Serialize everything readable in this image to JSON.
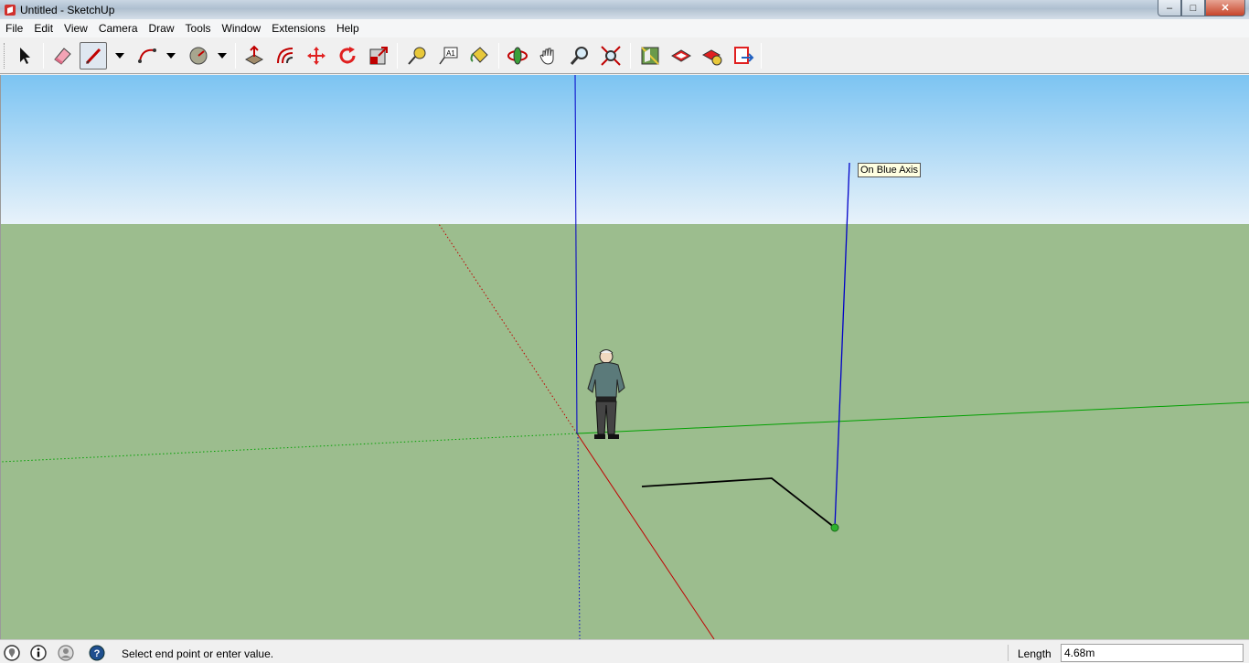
{
  "window": {
    "title": "Untitled - SketchUp",
    "controls": {
      "minimize": "–",
      "maximize": "□",
      "close": "✕"
    }
  },
  "menu": [
    "File",
    "Edit",
    "View",
    "Camera",
    "Draw",
    "Tools",
    "Window",
    "Extensions",
    "Help"
  ],
  "toolbar": {
    "tools": [
      {
        "name": "select-tool-icon"
      },
      {
        "name": "eraser-tool-icon"
      },
      {
        "name": "line-tool-icon",
        "active": true
      },
      {
        "name": "arc-tool-icon"
      },
      {
        "name": "shapes-tool-icon"
      },
      {
        "name": "push-pull-tool-icon"
      },
      {
        "name": "offset-tool-icon"
      },
      {
        "name": "move-tool-icon"
      },
      {
        "name": "rotate-tool-icon"
      },
      {
        "name": "scale-tool-icon"
      },
      {
        "name": "tape-measure-tool-icon"
      },
      {
        "name": "text-tool-icon"
      },
      {
        "name": "paint-bucket-tool-icon"
      },
      {
        "name": "orbit-tool-icon"
      },
      {
        "name": "pan-tool-icon"
      },
      {
        "name": "zoom-tool-icon"
      },
      {
        "name": "zoom-extents-tool-icon"
      },
      {
        "name": "warehouse-icon"
      },
      {
        "name": "extension-warehouse-icon"
      },
      {
        "name": "extension-manager-icon"
      },
      {
        "name": "send-to-layout-icon"
      }
    ],
    "text_tool_glyph": "A1"
  },
  "viewport": {
    "inference_tooltip": "On Blue Axis",
    "colors": {
      "sky_top": "#7cc4f2",
      "sky_bottom": "#e8f2fa",
      "ground": "#9cbd8e",
      "red_axis": "#c00000",
      "green_axis": "#00a000",
      "blue_axis": "#0000c8",
      "edge": "#000000",
      "endpoint": "#2db32d"
    }
  },
  "status": {
    "message": "Select end point or enter value.",
    "measure_label": "Length",
    "measure_value": "4.68m",
    "icons": [
      "geo-location-icon",
      "credits-icon",
      "user-account-icon",
      "instructor-help-icon"
    ]
  }
}
